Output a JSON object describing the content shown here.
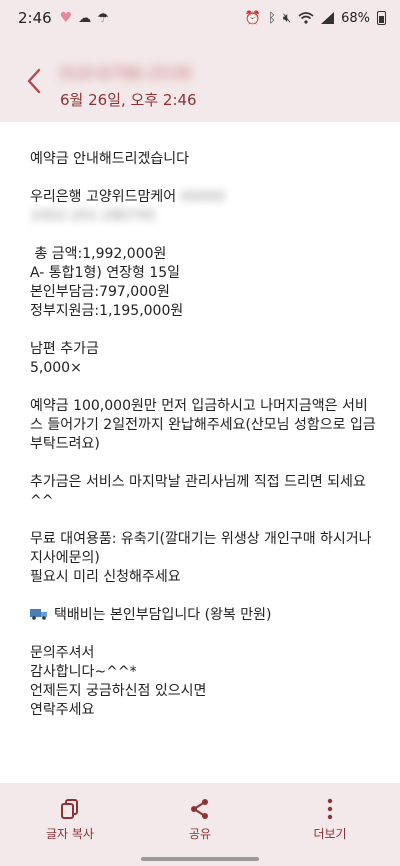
{
  "status_bar": {
    "time": "2:46",
    "battery": "68%",
    "icons": [
      "heart-icon",
      "weather-icon",
      "cloud-icon",
      "alarm-icon",
      "bluetooth-icon",
      "mute-icon",
      "wifi-icon",
      "signal-icon",
      "battery-icon"
    ]
  },
  "header": {
    "sender": "010-6796-2539",
    "timestamp": "6월 26일, 오후 2:46"
  },
  "message": {
    "lines": [
      "예약금 안내해드리겠습니다",
      "",
      "우리은행  고양위드맘케어",
      "",
      " 총 금액:1,992,000원",
      "A- 통합1형) 연장형 15일",
      "본인부담금:797,000원",
      "정부지원금:1,195,000원",
      "",
      "남편 추가금",
      "5,000×",
      "",
      "예약금 100,000원만 먼저 입금하시고 나머지금액은 서비스 들어가기 2일전까지 완납해주세요(산모님 성함으로 입금 부탁드려요)",
      "",
      "추가금은 서비스 마지막날 관리사님께 직접 드리면 되세요^^",
      "",
      "무료 대여용품: 유축기(깔대기는 위생상 개인구매 하시거나 지사에문의)",
      "필요시 미리 신청해주세요",
      "",
      "택배비는 본인부담입니다 (왕복 만원)",
      "",
      "문의주셔서",
      "감사합니다~^^*",
      "언제든지 궁금하신점 있으시면",
      "연락주세요"
    ],
    "redacted_account_holder": "00000",
    "redacted_account_number": "1002-201-280745"
  },
  "actions": {
    "copy": "글자 복사",
    "share": "공유",
    "more": "더보기"
  },
  "colors": {
    "accent": "#8e3335",
    "bar_background": "#f3e9ea"
  }
}
